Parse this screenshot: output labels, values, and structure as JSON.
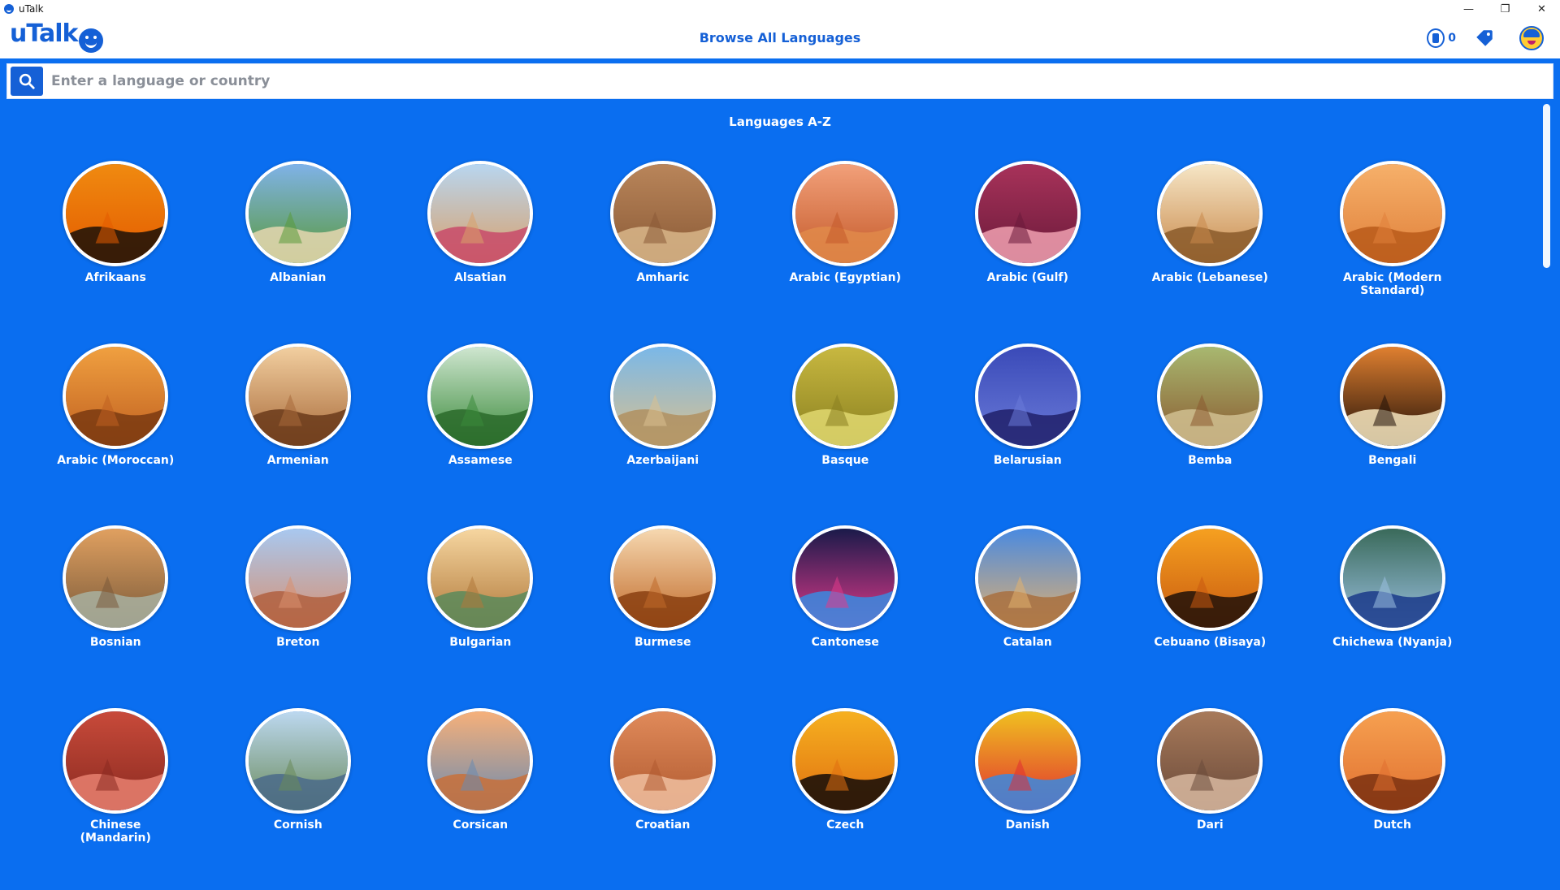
{
  "window": {
    "title": "uTalk",
    "minimize": "—",
    "maximize": "❐",
    "close": "✕"
  },
  "header": {
    "logo_text": "uTalk",
    "page_title": "Browse All Languages",
    "coins": "0"
  },
  "search": {
    "placeholder": "Enter a language or country",
    "value": ""
  },
  "section_title": "Languages A-Z",
  "colors": {
    "brand": "#1560d6",
    "background": "#0a6ef0"
  },
  "languages": [
    {
      "name": "Afrikaans",
      "theme": [
        "#f08a10",
        "#e35b00",
        "#1a1008"
      ]
    },
    {
      "name": "Albanian",
      "theme": [
        "#7fb2e8",
        "#5a9a3a",
        "#e6d7b0"
      ]
    },
    {
      "name": "Alsatian",
      "theme": [
        "#b8d6f0",
        "#d9a06a",
        "#c84a6a"
      ]
    },
    {
      "name": "Amharic",
      "theme": [
        "#b9855a",
        "#8a5a36",
        "#d8b68a"
      ]
    },
    {
      "name": "Arabic (Egyptian)",
      "theme": [
        "#f2a07a",
        "#c45a2a",
        "#e08a4a"
      ]
    },
    {
      "name": "Arabic (Gulf)",
      "theme": [
        "#a8325a",
        "#6a1a3a",
        "#f0a0b0"
      ]
    },
    {
      "name": "Arabic (Lebanese)",
      "theme": [
        "#f6e6c6",
        "#c8884a",
        "#8a5a2a"
      ]
    },
    {
      "name": "Arabic (Modern Standard)",
      "theme": [
        "#f6b06a",
        "#e0803a",
        "#b85a1a"
      ]
    },
    {
      "name": "Arabic (Moroccan)",
      "theme": [
        "#f0a040",
        "#c06020",
        "#7a3a10"
      ]
    },
    {
      "name": "Armenian",
      "theme": [
        "#f2cfa0",
        "#a86a3a",
        "#6a3a1a"
      ]
    },
    {
      "name": "Assamese",
      "theme": [
        "#cfe6d0",
        "#3a8a3a",
        "#2a6a2a"
      ]
    },
    {
      "name": "Azerbaijani",
      "theme": [
        "#7ab8e8",
        "#d8c090",
        "#b09060"
      ]
    },
    {
      "name": "Basque",
      "theme": [
        "#c8b840",
        "#8a8020",
        "#e0d870"
      ]
    },
    {
      "name": "Belarusian",
      "theme": [
        "#3a4ab8",
        "#6a7ad8",
        "#20206a"
      ]
    },
    {
      "name": "Bemba",
      "theme": [
        "#a8b870",
        "#8a5a30",
        "#d0c090"
      ]
    },
    {
      "name": "Bengali",
      "theme": [
        "#e08030",
        "#201008",
        "#f6e6c0"
      ]
    },
    {
      "name": "Bosnian",
      "theme": [
        "#e0a060",
        "#7a5a3a",
        "#a8b0a0"
      ]
    },
    {
      "name": "Breton",
      "theme": [
        "#a8c8f0",
        "#d89070",
        "#b06040"
      ]
    },
    {
      "name": "Bulgarian",
      "theme": [
        "#f6d6a0",
        "#b0783a",
        "#5a8a5a"
      ]
    },
    {
      "name": "Burmese",
      "theme": [
        "#f6d8b0",
        "#c06a2a",
        "#8a4010"
      ]
    },
    {
      "name": "Cantonese",
      "theme": [
        "#1a1a4a",
        "#e03a8a",
        "#3a8ae0"
      ]
    },
    {
      "name": "Catalan",
      "theme": [
        "#4a8ae0",
        "#e0b070",
        "#a87040"
      ]
    },
    {
      "name": "Cebuano (Bisaya)",
      "theme": [
        "#f6a020",
        "#c85a10",
        "#201008"
      ]
    },
    {
      "name": "Chichewa (Nyanja)",
      "theme": [
        "#3a6a5a",
        "#9ac0e0",
        "#1a3a8a"
      ]
    },
    {
      "name": "Chinese (Mandarin)",
      "theme": [
        "#c84a3a",
        "#8a2a20",
        "#e88070"
      ]
    },
    {
      "name": "Cornish",
      "theme": [
        "#bcd8f0",
        "#6a8a5a",
        "#4a6a8a"
      ]
    },
    {
      "name": "Corsican",
      "theme": [
        "#f6b07a",
        "#6a8ab0",
        "#c8703a"
      ]
    },
    {
      "name": "Croatian",
      "theme": [
        "#e08a5a",
        "#b05a30",
        "#f0c0a0"
      ]
    },
    {
      "name": "Czech",
      "theme": [
        "#f6b020",
        "#e07010",
        "#100a08"
      ]
    },
    {
      "name": "Danish",
      "theme": [
        "#f0c020",
        "#e03030",
        "#3a8ae0"
      ]
    },
    {
      "name": "Dari",
      "theme": [
        "#a87a5a",
        "#6a4a3a",
        "#d8b8a0"
      ]
    },
    {
      "name": "Dutch",
      "theme": [
        "#f6a050",
        "#e07030",
        "#7a3010"
      ]
    }
  ]
}
